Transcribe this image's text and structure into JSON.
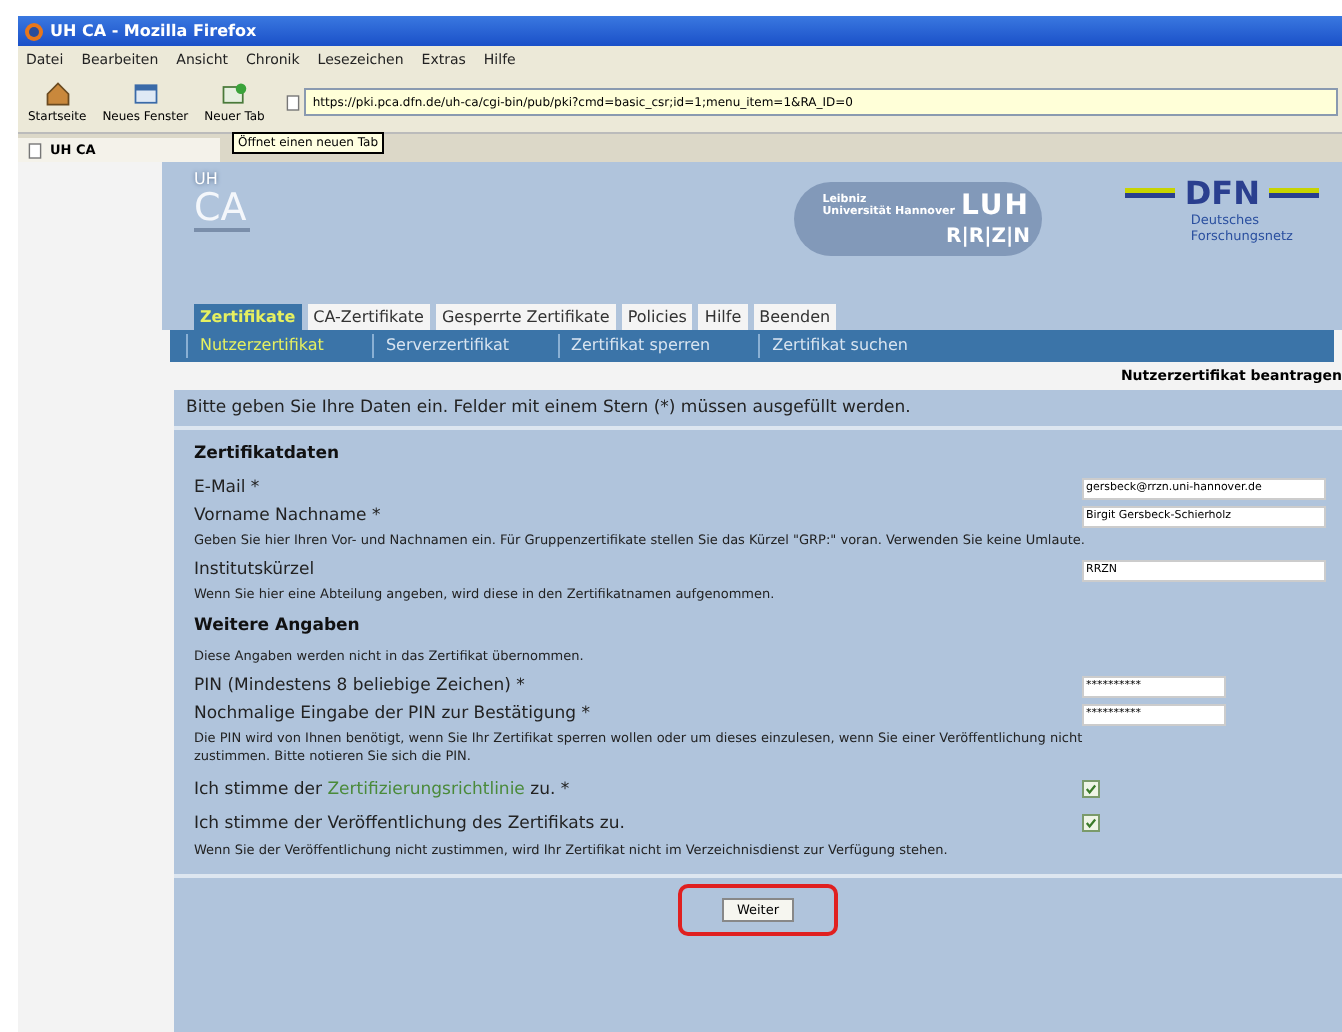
{
  "window": {
    "title": "UH CA - Mozilla Firefox"
  },
  "menu": [
    "Datei",
    "Bearbeiten",
    "Ansicht",
    "Chronik",
    "Lesezeichen",
    "Extras",
    "Hilfe"
  ],
  "toolbar": [
    {
      "label": "Startseite",
      "kind": "home"
    },
    {
      "label": "Neues Fenster",
      "kind": "window"
    },
    {
      "label": "Neuer Tab",
      "kind": "tab"
    }
  ],
  "address": {
    "value": "https://pki.pca.dfn.de/uh-ca/cgi-bin/pub/pki?cmd=basic_csr;id=1;menu_item=1&RA_ID=0"
  },
  "browser_tabs": [
    {
      "label": "UH CA",
      "selected": true
    }
  ],
  "tooltip": "Öffnet einen neuen Tab",
  "header": {
    "uh": "UH",
    "ca": "CA",
    "university": "Leibniz\nUniversität Hannover",
    "luh": "LUH",
    "rrzn": "R|R|Z|N",
    "dfn": "DFN",
    "dfn_sub": "Deutsches\nForschungsnetz"
  },
  "tabs": [
    {
      "label": "Zertifikate",
      "selected": true
    },
    {
      "label": "CA-Zertifikate",
      "selected": false
    },
    {
      "label": "Gesperrte Zertifikate",
      "selected": false
    },
    {
      "label": "Policies",
      "selected": false
    },
    {
      "label": "Hilfe",
      "selected": false
    },
    {
      "label": "Beenden",
      "selected": false
    }
  ],
  "subtabs": [
    {
      "label": "Nutzerzertifikat",
      "selected": true
    },
    {
      "label": "Serverzertifikat",
      "selected": false
    },
    {
      "label": "Zertifikat sperren",
      "selected": false
    },
    {
      "label": "Zertifikat suchen",
      "selected": false
    }
  ],
  "page_title": "Nutzerzertifikat beantragen",
  "intro": "Bitte geben Sie Ihre Daten ein. Felder mit einem Stern (*) müssen ausgefüllt werden.",
  "sections": [
    {
      "heading": "Zertifikatdaten",
      "rows": [
        {
          "kind": "field",
          "label": "E-Mail *",
          "value": "gersbeck@rrzn.uni-hannover.de"
        },
        {
          "kind": "field",
          "label": "Vorname Nachname *",
          "value": "Birgit Gersbeck-Schierholz"
        },
        {
          "kind": "note",
          "text": "Geben Sie hier Ihren Vor- und Nachnamen ein. Für Gruppenzertifikate stellen Sie das Kürzel \"GRP:\" voran. Verwenden Sie keine Umlaute."
        },
        {
          "kind": "field",
          "label": "Institutskürzel",
          "value": "RRZN"
        },
        {
          "kind": "note",
          "text": "Wenn Sie hier eine Abteilung angeben, wird diese in den Zertifikatnamen aufgenommen."
        }
      ]
    },
    {
      "heading": "Weitere Angaben",
      "rows": [
        {
          "kind": "note",
          "text": "Diese Angaben werden nicht in das Zertifikat übernommen."
        },
        {
          "kind": "pin",
          "label": "PIN (Mindestens 8 beliebige Zeichen) *",
          "value": "**********"
        },
        {
          "kind": "pin",
          "label": "Nochmalige Eingabe der PIN zur Bestätigung *",
          "value": "**********"
        },
        {
          "kind": "note",
          "text": "Die PIN wird von Ihnen benötigt, wenn Sie Ihr Zertifikat sperren wollen oder um dieses einzulesen, wenn Sie einer Veröffentlichung nicht zustimmen. Bitte notieren Sie sich die PIN."
        },
        {
          "kind": "check",
          "before": "Ich stimme der ",
          "link": "Zertifizierungsrichtlinie",
          "after": " zu. *",
          "checked": true
        },
        {
          "kind": "check",
          "before": "Ich stimme der Veröffentlichung des Zertifikats zu.",
          "checked": true
        },
        {
          "kind": "note",
          "text": "Wenn Sie der Veröffentlichung nicht zustimmen, wird Ihr Zertifikat nicht im Verzeichnisdienst zur Verfügung stehen."
        }
      ]
    }
  ],
  "submit": "Weiter"
}
